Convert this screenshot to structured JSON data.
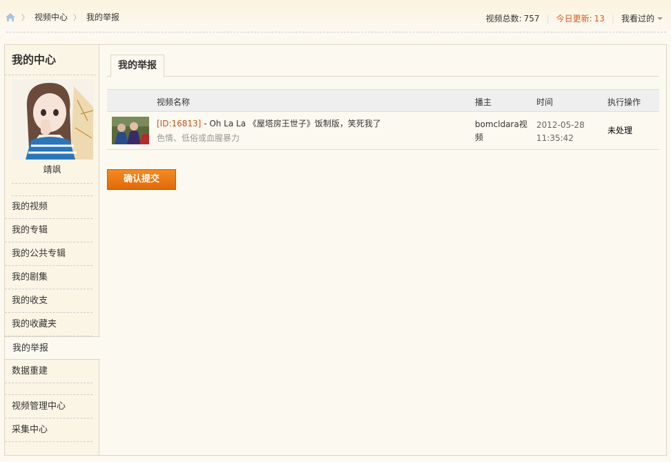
{
  "breadcrumb": {
    "items": [
      "视频中心",
      "我的举报"
    ]
  },
  "stats": {
    "total_label": "视频总数:",
    "total_value": "757",
    "today_label": "今日更新:",
    "today_value": "13",
    "history_label": "我看过的"
  },
  "sidebar": {
    "title": "我的中心",
    "username": "靖飒",
    "items": [
      {
        "label": "我的视频"
      },
      {
        "label": "我的专辑"
      },
      {
        "label": "我的公共专辑"
      },
      {
        "label": "我的剧集"
      },
      {
        "label": "我的收支"
      },
      {
        "label": "我的收藏夹"
      },
      {
        "label": "我的举报"
      },
      {
        "label": "数据重建"
      },
      {
        "label": "视频管理中心"
      },
      {
        "label": "采集中心"
      }
    ]
  },
  "main": {
    "tab_label": "我的举报",
    "table": {
      "headers": [
        "视频名称",
        "播主",
        "时间",
        "执行操作"
      ],
      "rows": [
        {
          "id": "[ID:16813]",
          "title": " - Oh La La 《屋塔房王世子》饭制版，笑死我了",
          "reason": "色情、低俗或血腥暴力",
          "uploader": "bomcldara视频",
          "date": "2012-05-28",
          "time": "11:35:42",
          "status": "未处理"
        }
      ]
    },
    "submit_label": "确认提交"
  },
  "colors": {
    "accent_orange": "#f07a16",
    "id_red": "#c4541b",
    "background": "#fcf9f1"
  }
}
